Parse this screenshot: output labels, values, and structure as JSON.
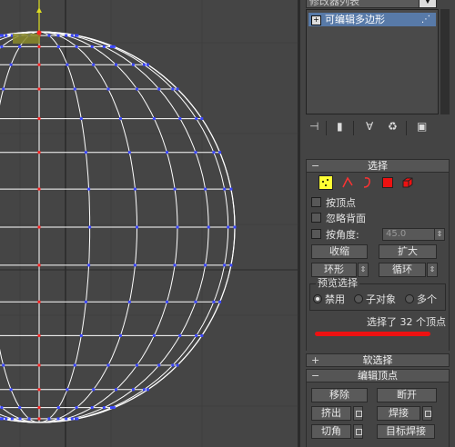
{
  "modifier_list": {
    "label": "修改器列表"
  },
  "stack": {
    "item_label": "可编辑多边形"
  },
  "selection": {
    "title": "选择",
    "by_vertex": "按顶点",
    "ignore_backfacing": "忽略背面",
    "by_angle": "按角度:",
    "angle_value": "45.0",
    "shrink": "收缩",
    "grow": "扩大",
    "ring": "环形",
    "loop": "循环",
    "preview_title": "预览选择",
    "preview_off": "禁用",
    "preview_subobject": "子对象",
    "preview_multi": "多个",
    "status": "选择了 32 个顶点"
  },
  "soft_selection": {
    "title": "软选择"
  },
  "edit_vertices": {
    "title": "编辑顶点",
    "remove": "移除",
    "break": "断开",
    "extrude": "挤出",
    "weld": "焊接",
    "chamfer": "切角",
    "target_weld": "目标焊接"
  },
  "colors": {
    "viewport_bg": "#454545",
    "wire": "#ffffff",
    "vertex": "#3b47ff",
    "selected_vertex": "#ff2020",
    "stack_highlight": "#587aa8",
    "annotation": "#ee1111"
  }
}
